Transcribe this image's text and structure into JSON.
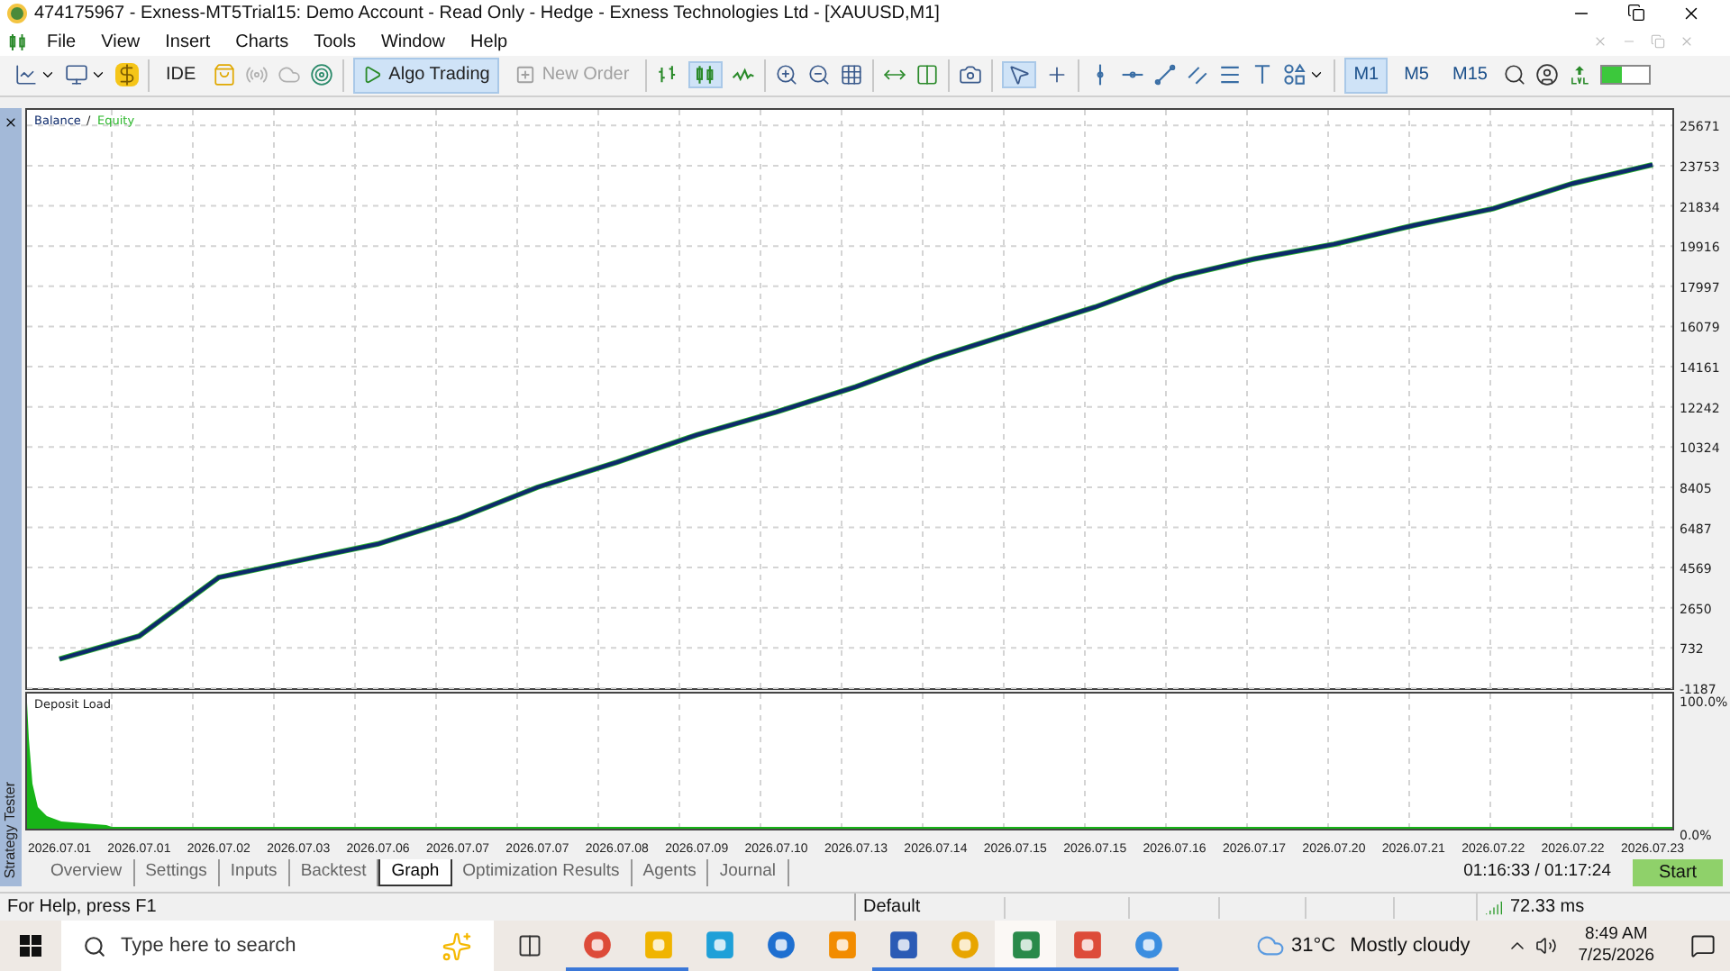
{
  "window": {
    "title": "474175967 - Exness-MT5Trial15: Demo Account - Read Only - Hedge - Exness Technologies Ltd - [XAUUSD,M1]"
  },
  "menu": [
    "File",
    "View",
    "Insert",
    "Charts",
    "Tools",
    "Window",
    "Help"
  ],
  "toolbar": {
    "text_buttons": [
      {
        "label": "IDE",
        "selected": false,
        "disabled": false
      },
      {
        "label": "Algo Trading",
        "selected": true,
        "disabled": false
      },
      {
        "label": "New Order",
        "selected": false,
        "disabled": true
      }
    ],
    "timeframes": [
      {
        "label": "M1",
        "selected": true
      },
      {
        "label": "M5",
        "selected": false
      },
      {
        "label": "M15",
        "selected": false
      }
    ],
    "meter": {
      "level": 0.4
    }
  },
  "side_panel": {
    "title": "Strategy Tester"
  },
  "chart": {
    "legend_separator": "/",
    "date_labels": [
      "2026.07.01",
      "2026.07.01",
      "2026.07.02",
      "2026.07.03",
      "2026.07.06",
      "2026.07.07",
      "2026.07.07",
      "2026.07.08",
      "2026.07.09",
      "2026.07.10",
      "2026.07.13",
      "2026.07.14",
      "2026.07.15",
      "2026.07.15",
      "2026.07.16",
      "2026.07.17",
      "2026.07.20",
      "2026.07.21",
      "2026.07.22",
      "2026.07.22",
      "2026.07.23"
    ],
    "chart_data": {
      "type": "line",
      "grid": true,
      "series": [
        {
          "name": "Balance",
          "color": "#0d2a6b",
          "values": [
            200,
            1300,
            4100,
            4900,
            5700,
            6900,
            8400,
            9600,
            10900,
            12000,
            13200,
            14600,
            15800,
            17000,
            18400,
            19300,
            20000,
            20900,
            21700,
            22900,
            23800
          ]
        },
        {
          "name": "Equity",
          "color": "#2eb82e",
          "values": [
            200,
            1300,
            4100,
            4900,
            5700,
            6900,
            8400,
            9600,
            10900,
            12000,
            13200,
            14600,
            15800,
            17000,
            18400,
            19300,
            20000,
            20900,
            21700,
            22900,
            23800
          ]
        }
      ],
      "ylim": [
        -1187,
        26500
      ],
      "yticks": [
        25671,
        23753,
        21834,
        19916,
        17997,
        16079,
        14161,
        12242,
        10324,
        8405,
        6487,
        4569,
        2650,
        732,
        -1187
      ]
    },
    "deposit_load": {
      "title": "Deposit Load",
      "top_label": "100.0%",
      "bottom_label": "0.0%"
    }
  },
  "tester_tabs": [
    {
      "label": "Overview",
      "selected": false
    },
    {
      "label": "Settings",
      "selected": false
    },
    {
      "label": "Inputs",
      "selected": false
    },
    {
      "label": "Backtest",
      "selected": false
    },
    {
      "label": "Graph",
      "selected": true
    },
    {
      "label": "Optimization Results",
      "selected": false
    },
    {
      "label": "Agents",
      "selected": false
    },
    {
      "label": "Journal",
      "selected": false
    }
  ],
  "tester_time": "01:16:33 / 01:17:24",
  "start_button": "Start",
  "status_bar": {
    "help": "For Help, press F1",
    "profile": "Default",
    "ping": "72.33 ms"
  },
  "taskbar": {
    "search": {
      "placeholder": "Type here to search"
    },
    "apps": [
      {
        "running": true,
        "active": false
      },
      {
        "running": true,
        "active": false
      },
      {
        "running": false,
        "active": false
      },
      {
        "running": false,
        "active": false
      },
      {
        "running": false,
        "active": false
      },
      {
        "running": true,
        "active": false
      },
      {
        "running": true,
        "active": false
      },
      {
        "running": true,
        "active": true
      },
      {
        "running": true,
        "active": false
      },
      {
        "running": true,
        "active": false
      }
    ],
    "weather": {
      "temperature": "31°C",
      "condition": "Mostly cloudy"
    },
    "time": "8:49 AM",
    "date": "7/25/2026"
  }
}
